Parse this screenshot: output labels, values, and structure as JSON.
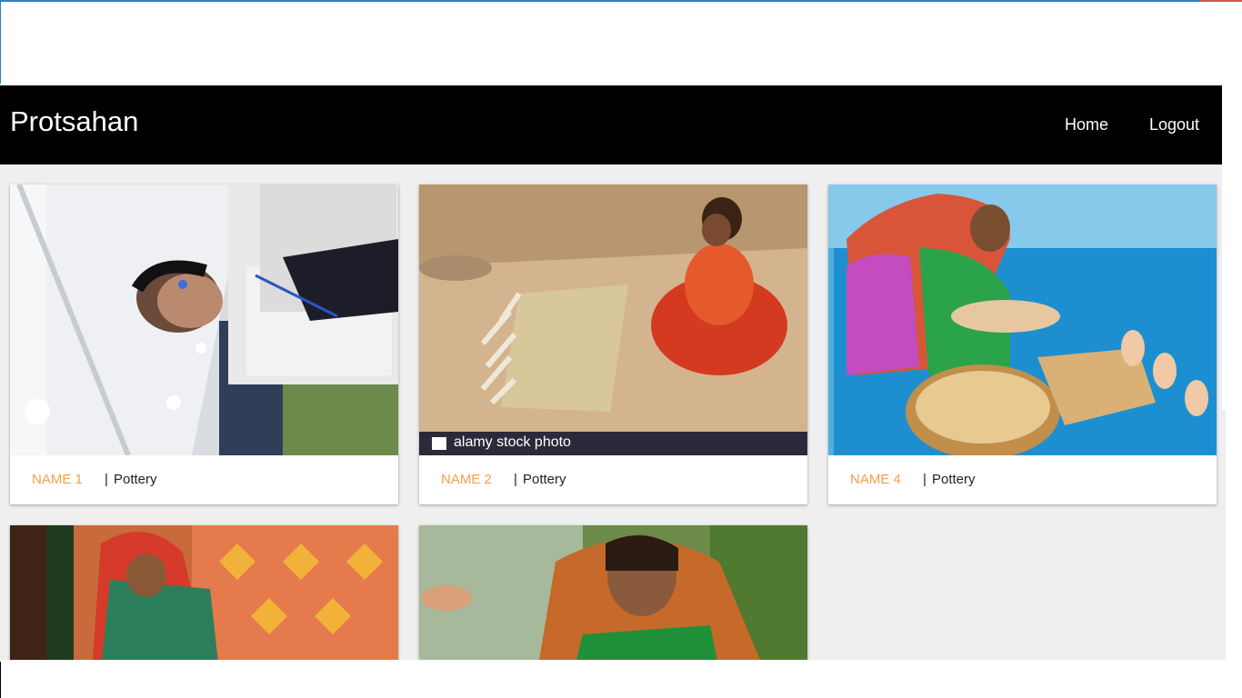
{
  "navbar": {
    "brand": "Protsahan",
    "links": [
      {
        "label": "Home"
      },
      {
        "label": "Logout"
      }
    ]
  },
  "cards": [
    {
      "name": "NAME 1",
      "separator": "|",
      "craft": "Pottery"
    },
    {
      "name": "NAME 2",
      "separator": "|",
      "craft": "Pottery",
      "watermark": "alamy stock photo"
    },
    {
      "name": "NAME 4",
      "separator": "|",
      "craft": "Pottery"
    },
    {
      "name": "",
      "separator": "",
      "craft": ""
    },
    {
      "name": "",
      "separator": "",
      "craft": ""
    }
  ],
  "colors": {
    "navbar_bg": "#000000",
    "name_accent": "#f4a04a",
    "page_bg": "#efefef"
  }
}
